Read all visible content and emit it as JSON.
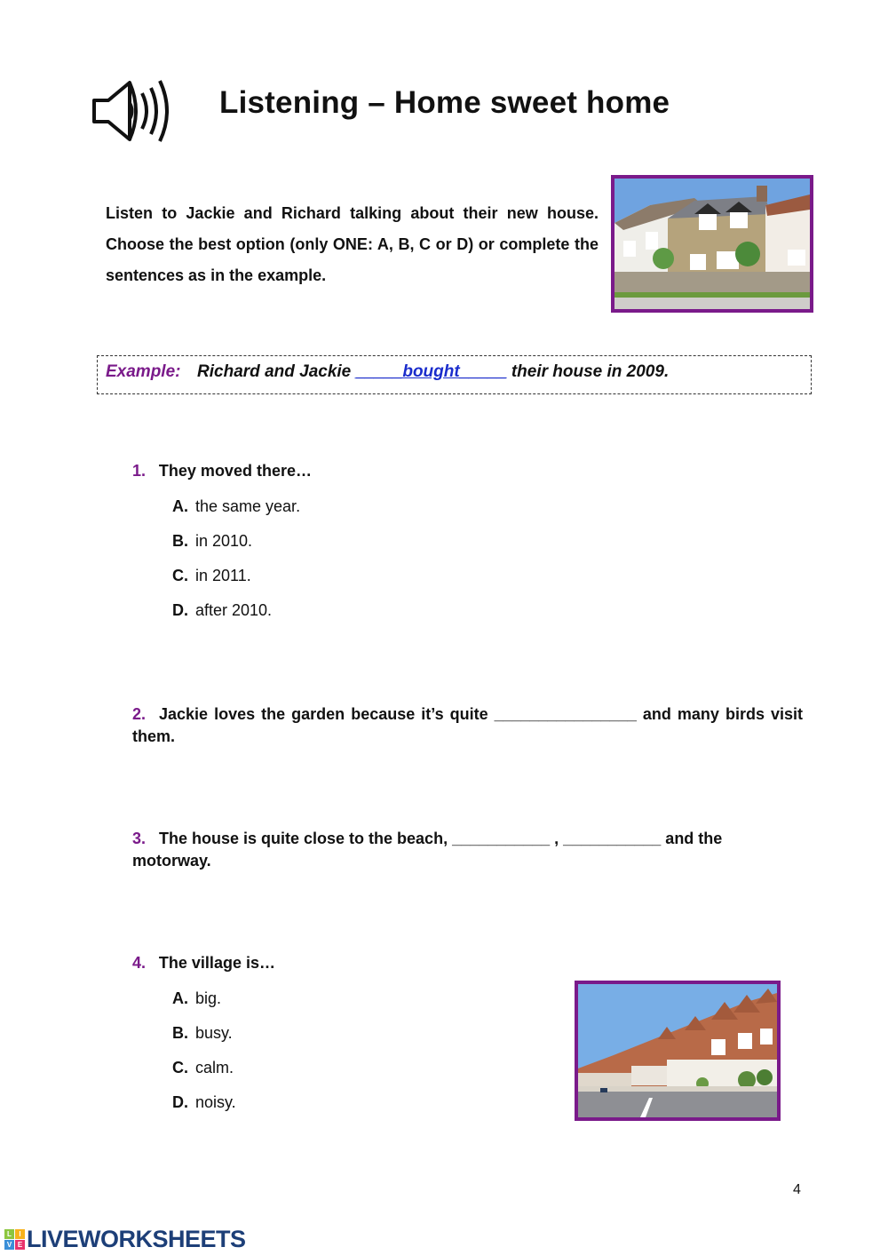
{
  "header": {
    "icon": "speaker-icon",
    "title": "Listening – Home sweet home"
  },
  "instructions": "Listen to Jackie and Richard talking about their new house. Choose the best option (only ONE: A, B, C or D) or complete the sentences as in the example.",
  "images": {
    "top": "terraced-cottages-photo",
    "bottom": "seaside-street-houses-photo"
  },
  "example": {
    "label": "Example:",
    "before": "Richard and Jackie ",
    "answer": "_____bought_____",
    "after": " their house in 2009."
  },
  "questions": [
    {
      "number": "1.",
      "text": "They moved there…",
      "options": [
        {
          "letter": "A.",
          "text": "the same year."
        },
        {
          "letter": "B.",
          "text": "in 2010."
        },
        {
          "letter": "C.",
          "text": "in 2011."
        },
        {
          "letter": "D.",
          "text": "after 2010."
        }
      ]
    },
    {
      "number": "2.",
      "text": "Jackie loves the garden because it’s quite ________________ and many birds visit them."
    },
    {
      "number": "3.",
      "text": "The house is quite close to the beach, ___________ , ___________ and the motorway."
    },
    {
      "number": "4.",
      "text": "The village is…",
      "options": [
        {
          "letter": "A.",
          "text": "big."
        },
        {
          "letter": "B.",
          "text": "busy."
        },
        {
          "letter": "C.",
          "text": "calm."
        },
        {
          "letter": "D.",
          "text": "noisy."
        }
      ]
    }
  ],
  "page_number": "4",
  "footer": {
    "logo_letters": [
      "L",
      "I",
      "V",
      "E"
    ],
    "logo_colors": [
      "#8cc63f",
      "#f7b21b",
      "#3a8fd8",
      "#e8336d"
    ],
    "brand": "LIVEWORKSHEETS"
  },
  "colors": {
    "accent_purple": "#7a1a8a",
    "answer_blue": "#1a2ccc",
    "logo_text": "#1d3f78"
  }
}
